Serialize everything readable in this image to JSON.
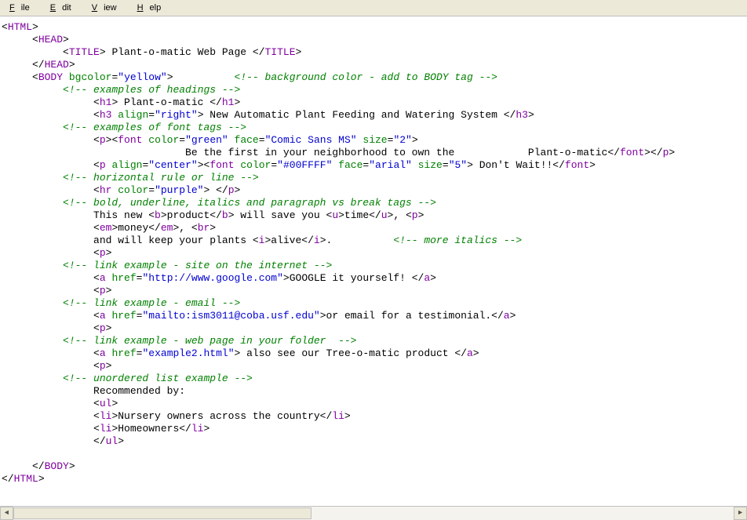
{
  "menu": {
    "file": "File",
    "edit": "Edit",
    "view": "View",
    "help": "Help"
  },
  "code": {
    "l1a": "<",
    "l1t": "HTML",
    "l1b": ">",
    "l2a": "     <",
    "l2t": "HEAD",
    "l2b": ">",
    "l3a": "          <",
    "l3t1": "TITLE",
    "l3b": "> Plant-o-matic Web Page </",
    "l3t2": "TITLE",
    "l3c": ">",
    "l4a": "     </",
    "l4t": "HEAD",
    "l4b": ">",
    "l5a": "     <",
    "l5t": "BODY",
    "l5b": " ",
    "l5attr": "bgcolor",
    "l5eq": "=",
    "l5v": "\"yellow\"",
    "l5c": ">          ",
    "l5comm": "<!-- background color - add to BODY tag -->",
    "l6a": "          ",
    "l6comm": "<!-- examples of headings -->",
    "l7a": "               <",
    "l7t1": "h1",
    "l7b": "> Plant-o-matic </",
    "l7t2": "h1",
    "l7c": ">",
    "l8a": "               <",
    "l8t1": "h3",
    "l8b": " ",
    "l8attr": "align",
    "l8eq": "=",
    "l8v": "\"right\"",
    "l8c": "> New Automatic Plant Feeding and Watering System </",
    "l8t2": "h3",
    "l8d": ">",
    "l9a": "          ",
    "l9comm": "<!-- examples of font tags -->",
    "l10a": "               <",
    "l10t1": "p",
    "l10b": "><",
    "l10t2": "font",
    "l10c": " ",
    "l10a1": "color",
    "l10e1": "=",
    "l10v1": "\"green\"",
    "l10s1": " ",
    "l10a2": "face",
    "l10e2": "=",
    "l10v2": "\"Comic Sans MS\"",
    "l10s2": " ",
    "l10a3": "size",
    "l10e3": "=",
    "l10v3": "\"2\"",
    "l10d": ">",
    "l11a": "                              Be the first in your neighborhood to own the            Plant-o-matic</",
    "l11t1": "font",
    "l11b": "></",
    "l11t2": "p",
    "l11c": ">",
    "l12a": "               <",
    "l12t1": "p",
    "l12b": " ",
    "l12a1": "align",
    "l12e1": "=",
    "l12v1": "\"center\"",
    "l12c": "><",
    "l12t2": "font",
    "l12d": " ",
    "l12a2": "color",
    "l12e2": "=",
    "l12v2": "\"#00FFFF\"",
    "l12s2": " ",
    "l12a3": "face",
    "l12e3": "=",
    "l12v3": "\"arial\"",
    "l12s3": " ",
    "l12a4": "size",
    "l12e4": "=",
    "l12v4": "\"5\"",
    "l12e": "> Don't Wait!!</",
    "l12t3": "font",
    "l12f": ">",
    "l13a": "          ",
    "l13comm": "<!-- horizontal rule or line -->",
    "l14a": "               <",
    "l14t1": "hr",
    "l14b": " ",
    "l14a1": "color",
    "l14e1": "=",
    "l14v1": "\"purple\"",
    "l14c": "> </",
    "l14t2": "p",
    "l14d": ">",
    "l15a": "          ",
    "l15comm": "<!-- bold, underline, italics and paragraph vs break tags -->",
    "l16a": "               This new <",
    "l16t1": "b",
    "l16b": ">product</",
    "l16t2": "b",
    "l16c": "> will save you <",
    "l16t3": "u",
    "l16d": ">time</",
    "l16t4": "u",
    "l16e": ">, <",
    "l16t5": "p",
    "l16f": ">",
    "l17a": "               <",
    "l17t1": "em",
    "l17b": ">money</",
    "l17t2": "em",
    "l17c": ">, <",
    "l17t3": "br",
    "l17d": ">",
    "l18a": "               and will keep your plants <",
    "l18t1": "i",
    "l18b": ">alive</",
    "l18t2": "i",
    "l18c": ">.          ",
    "l18comm": "<!-- more italics -->",
    "l19a": "               <",
    "l19t": "p",
    "l19b": ">",
    "l20a": "          ",
    "l20comm": "<!-- link example - site on the internet -->",
    "l21a": "               <",
    "l21t1": "a",
    "l21b": " ",
    "l21a1": "href",
    "l21e1": "=",
    "l21v1": "\"http://www.google.com\"",
    "l21c": ">GOOGLE it yourself! </",
    "l21t2": "a",
    "l21d": ">",
    "l22a": "               <",
    "l22t": "p",
    "l22b": ">",
    "l23a": "          ",
    "l23comm": "<!-- link example - email -->",
    "l24a": "               <",
    "l24t1": "a",
    "l24b": " ",
    "l24a1": "href",
    "l24e1": "=",
    "l24v1": "\"mailto:ism3011@coba.usf.edu\"",
    "l24c": ">or email for a testimonial.</",
    "l24t2": "a",
    "l24d": ">",
    "l25a": "               <",
    "l25t": "p",
    "l25b": ">",
    "l26a": "          ",
    "l26comm": "<!-- link example - web page in your folder  -->",
    "l27a": "               <",
    "l27t1": "a",
    "l27b": " ",
    "l27a1": "href",
    "l27e1": "=",
    "l27v1": "\"example2.html\"",
    "l27c": "> also see our Tree-o-matic product </",
    "l27t2": "a",
    "l27d": ">",
    "l28a": "               <",
    "l28t": "p",
    "l28b": ">",
    "l29a": "          ",
    "l29comm": "<!-- unordered list example -->",
    "l30": "               Recommended by:",
    "l31a": "               <",
    "l31t": "ul",
    "l31b": ">",
    "l32a": "               <",
    "l32t1": "li",
    "l32b": ">Nursery owners across the country</",
    "l32t2": "li",
    "l32c": ">",
    "l33a": "               <",
    "l33t1": "li",
    "l33b": ">Homeowners</",
    "l33t2": "li",
    "l33c": ">",
    "l34a": "               </",
    "l34t": "ul",
    "l34b": ">",
    "l35": "",
    "l36a": "     </",
    "l36t": "BODY",
    "l36b": ">",
    "l37a": "</",
    "l37t": "HTML",
    "l37b": ">"
  }
}
